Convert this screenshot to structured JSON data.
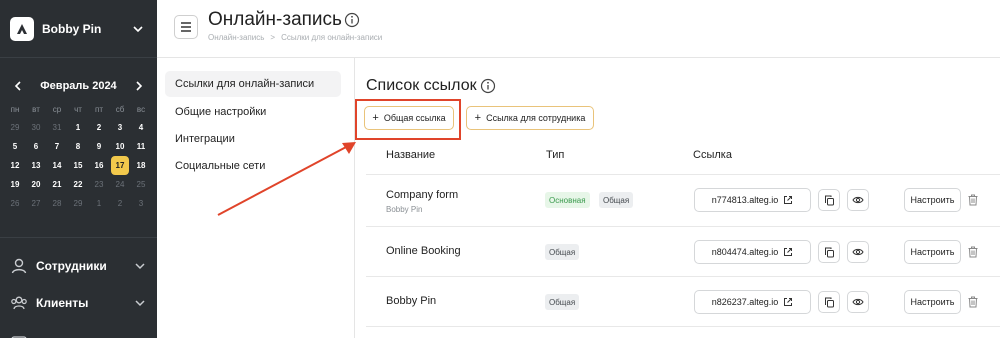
{
  "brand": {
    "name": "Bobby Pin"
  },
  "calendar": {
    "month": "Февраль 2024",
    "weekdays": [
      "пн",
      "вт",
      "ср",
      "чт",
      "пт",
      "сб",
      "вс"
    ],
    "days": [
      {
        "d": "29",
        "m": true
      },
      {
        "d": "30",
        "m": true
      },
      {
        "d": "31",
        "m": true
      },
      {
        "d": "1"
      },
      {
        "d": "2"
      },
      {
        "d": "3"
      },
      {
        "d": "4"
      },
      {
        "d": "5"
      },
      {
        "d": "6"
      },
      {
        "d": "7"
      },
      {
        "d": "8"
      },
      {
        "d": "9"
      },
      {
        "d": "10"
      },
      {
        "d": "11"
      },
      {
        "d": "12"
      },
      {
        "d": "13"
      },
      {
        "d": "14"
      },
      {
        "d": "15"
      },
      {
        "d": "16"
      },
      {
        "d": "17",
        "t": true
      },
      {
        "d": "18"
      },
      {
        "d": "19"
      },
      {
        "d": "20"
      },
      {
        "d": "21"
      },
      {
        "d": "22"
      },
      {
        "d": "23",
        "m": true
      },
      {
        "d": "24",
        "m": true
      },
      {
        "d": "25",
        "m": true
      },
      {
        "d": "26",
        "m": true
      },
      {
        "d": "27",
        "m": true
      },
      {
        "d": "28",
        "m": true
      },
      {
        "d": "29",
        "m": true
      },
      {
        "d": "1",
        "m": true
      },
      {
        "d": "2",
        "m": true
      },
      {
        "d": "3",
        "m": true
      }
    ]
  },
  "sidebar": {
    "items": [
      {
        "label": "Сотрудники",
        "icon": "user-icon"
      },
      {
        "label": "Клиенты",
        "icon": "users-icon"
      }
    ]
  },
  "header": {
    "title": "Онлайн-запись",
    "breadcrumb": [
      "Онлайн-запись",
      ">",
      "Ссылки для онлайн-записи"
    ]
  },
  "settings_nav": {
    "items": [
      "Ссылки для онлайн-записи",
      "Общие настройки",
      "Интеграции",
      "Социальные сети"
    ]
  },
  "main": {
    "title": "Список ссылок",
    "btn_general": "Общая ссылка",
    "btn_staff": "Ссылка для сотрудника",
    "plus": "+",
    "columns": {
      "name": "Название",
      "type": "Тип",
      "link": "Ссылка"
    },
    "configure_label": "Настроить",
    "rows": [
      {
        "name": "Company form",
        "sub": "Bobby Pin",
        "badges": [
          "Основная",
          "Общая"
        ],
        "link": "n774813.alteg.io"
      },
      {
        "name": "Online Booking",
        "sub": "",
        "badges": [
          "Общая"
        ],
        "link": "n804474.alteg.io"
      },
      {
        "name": "Bobby Pin",
        "sub": "",
        "badges": [
          "Общая"
        ],
        "link": "n826237.alteg.io"
      }
    ]
  },
  "colors": {
    "sidebar": "#2b2f33",
    "accent": "#f2c94c",
    "annotation": "#e0442a",
    "button_border": "#e9c37a"
  }
}
